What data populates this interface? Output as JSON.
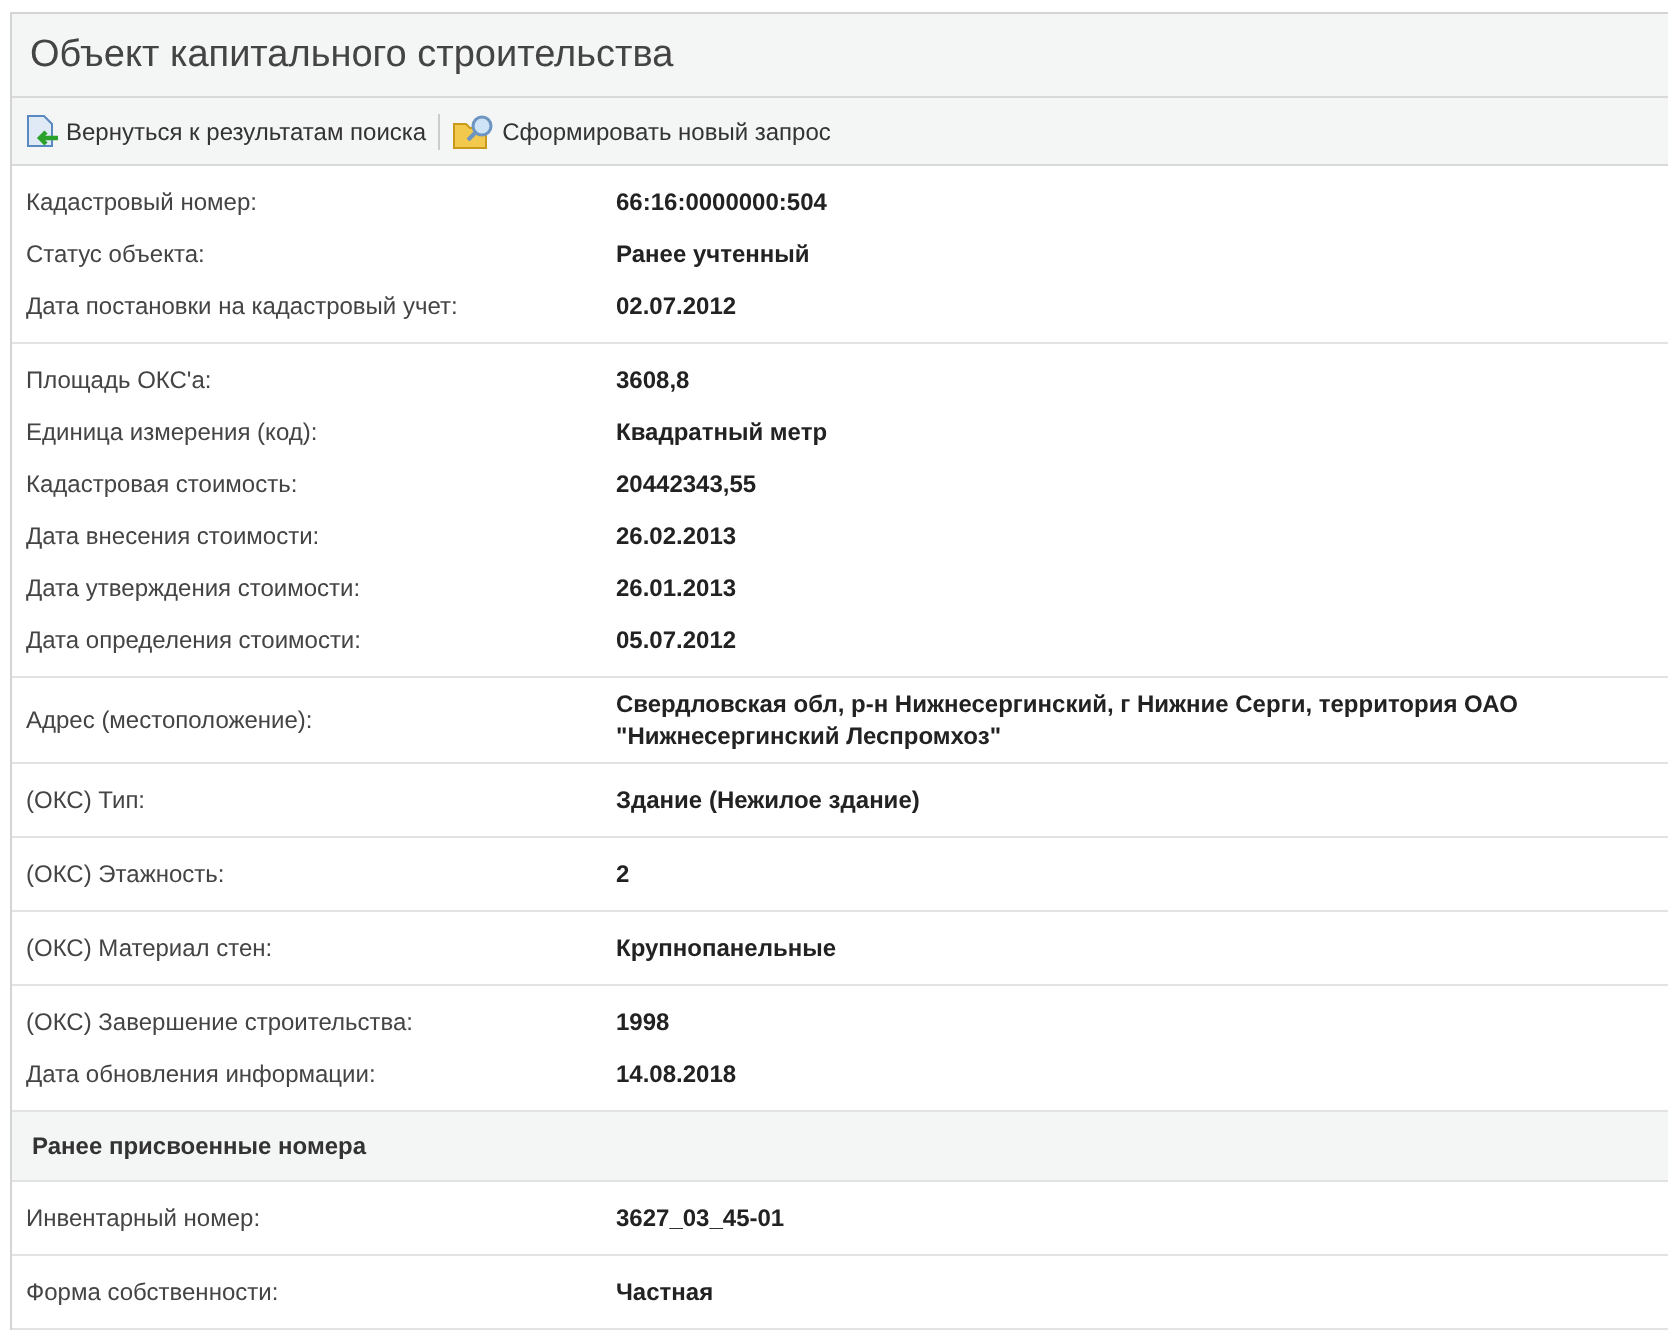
{
  "title": "Объект капитального строительства",
  "toolbar": [
    {
      "kind": "back",
      "label": "Вернуться к результатам поиска"
    },
    {
      "kind": "search",
      "label": "Сформировать новый запрос"
    }
  ],
  "blocks": [
    {
      "kind": "fields",
      "rows": [
        {
          "label": "Кадастровый номер:",
          "value": "66:16:0000000:504"
        },
        {
          "label": "Статус объекта:",
          "value": "Ранее учтенный"
        },
        {
          "label": "Дата постановки на кадастровый учет:",
          "value": "02.07.2012"
        }
      ]
    },
    {
      "kind": "fields",
      "rows": [
        {
          "label": "Площадь ОКС'а:",
          "value": "3608,8"
        },
        {
          "label": "Единица измерения (код):",
          "value": "Квадратный метр"
        },
        {
          "label": "Кадастровая стоимость:",
          "value": "20442343,55"
        },
        {
          "label": "Дата внесения стоимости:",
          "value": "26.02.2013"
        },
        {
          "label": "Дата утверждения стоимости:",
          "value": "26.01.2013"
        },
        {
          "label": "Дата определения стоимости:",
          "value": "05.07.2012"
        }
      ]
    },
    {
      "kind": "fields",
      "rows": [
        {
          "label": "Адрес (местоположение):",
          "value": "Свердловская обл, р-н Нижнесергинский, г Нижние Серги, территория ОАО \"Нижнесергинский Леспромхоз\""
        }
      ]
    },
    {
      "kind": "fields",
      "rows": [
        {
          "label": "(ОКС) Тип:",
          "value": "Здание (Нежилое здание)"
        }
      ]
    },
    {
      "kind": "fields",
      "rows": [
        {
          "label": "(ОКС) Этажность:",
          "value": "2"
        }
      ]
    },
    {
      "kind": "fields",
      "rows": [
        {
          "label": "(ОКС) Материал стен:",
          "value": "Крупнопанельные"
        }
      ]
    },
    {
      "kind": "fields",
      "rows": [
        {
          "label": "(ОКС) Завершение строительства:",
          "value": "1998"
        },
        {
          "label": "Дата обновления информации:",
          "value": "14.08.2018"
        }
      ]
    },
    {
      "kind": "heading",
      "text": "Ранее присвоенные номера"
    },
    {
      "kind": "fields",
      "rows": [
        {
          "label": "Инвентарный номер:",
          "value": "3627_03_45-01"
        }
      ]
    },
    {
      "kind": "fields",
      "rows": [
        {
          "label": "Форма собственности:",
          "value": "Частная"
        }
      ]
    }
  ]
}
